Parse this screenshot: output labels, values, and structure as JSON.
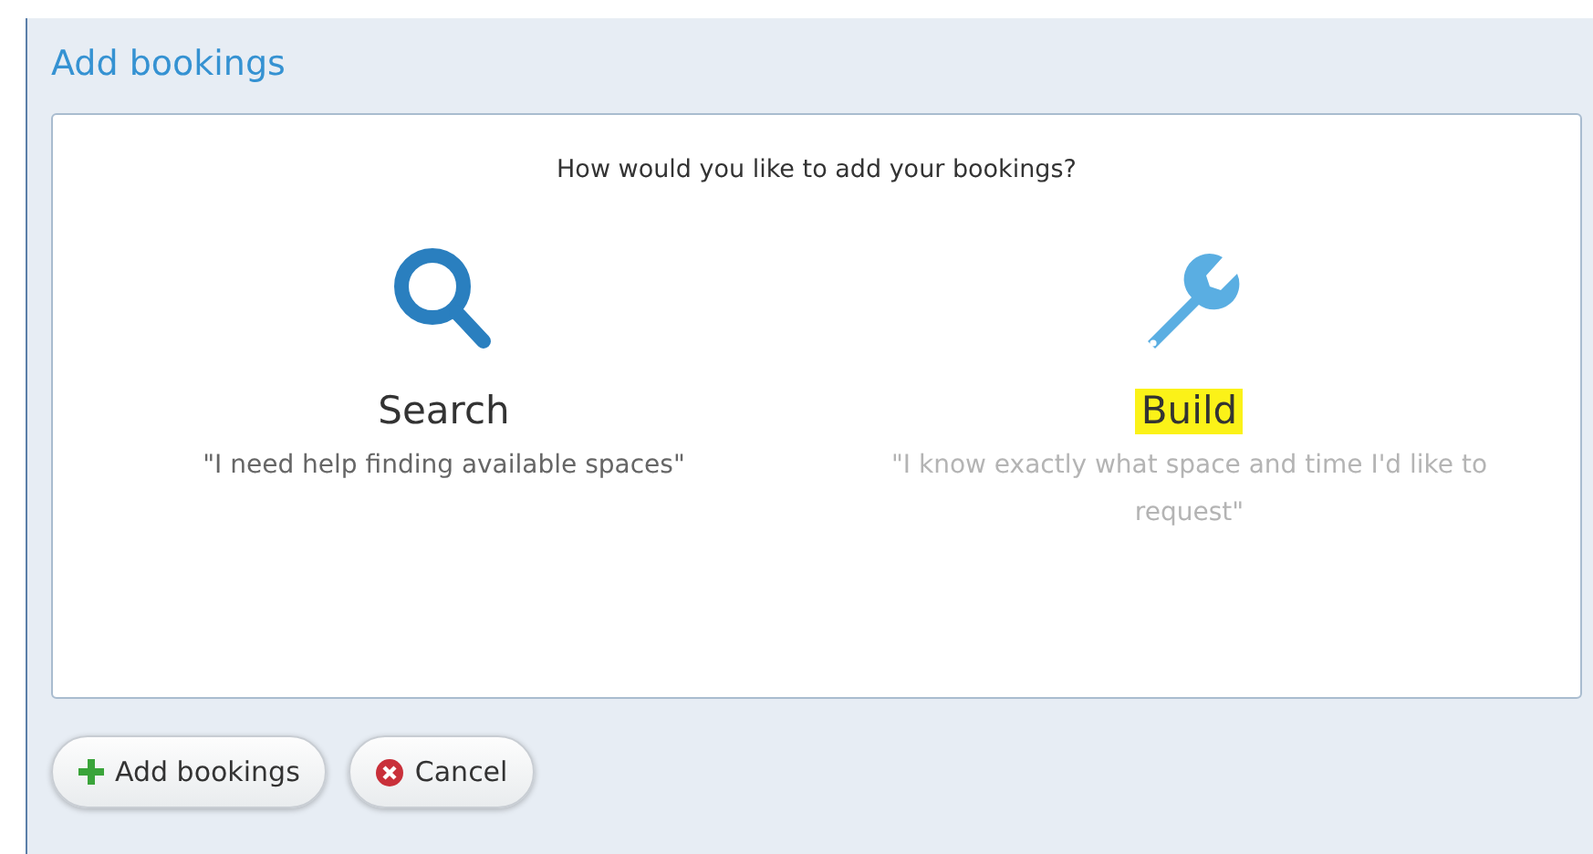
{
  "dialog": {
    "title": "Add bookings"
  },
  "prompt": "How would you like to add your bookings?",
  "options": [
    {
      "kind": "search",
      "label": "Search",
      "description": "\"I need help finding available spaces\"",
      "highlighted": false,
      "dimmed": false
    },
    {
      "kind": "build",
      "label": "Build",
      "description": "\"I know exactly what space and time I'd like to request\"",
      "highlighted": true,
      "dimmed": true
    }
  ],
  "buttons": [
    {
      "kind": "add",
      "label": "Add bookings"
    },
    {
      "kind": "cancel",
      "label": "Cancel"
    }
  ]
}
